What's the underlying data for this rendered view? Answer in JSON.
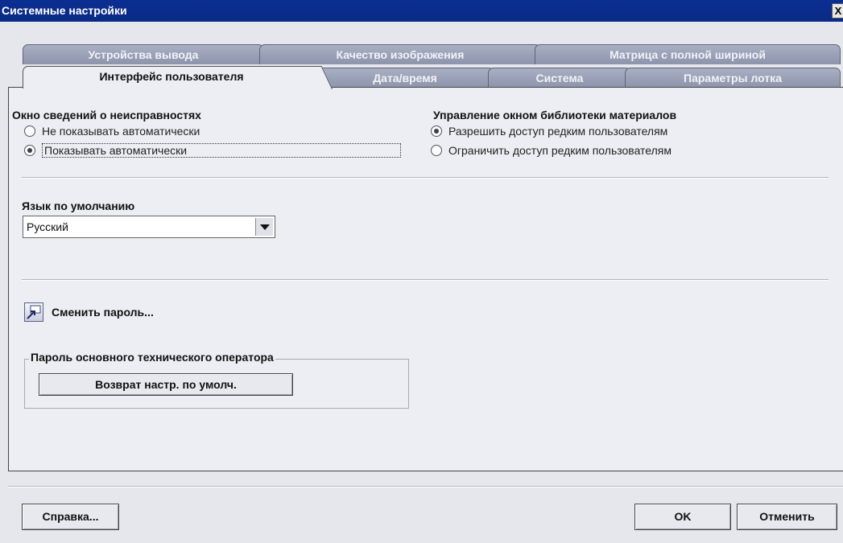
{
  "window": {
    "title": "Системные настройки",
    "close_label": "X"
  },
  "tabs": {
    "row1": [
      "Устройства вывода",
      "Качество изображения",
      "Матрица с полной шириной"
    ],
    "row2": [
      "Интерфейс пользователя",
      "Дата/время",
      "Система",
      "Параметры лотка"
    ],
    "active": "Интерфейс пользователя"
  },
  "fault_window": {
    "title": "Окно сведений о неисправностях",
    "options": [
      "Не показывать автоматически",
      "Показывать автоматически"
    ],
    "selected_index": 1
  },
  "library_window": {
    "title": "Управление окном библиотеки материалов",
    "options": [
      "Разрешить доступ редким пользователям",
      "Ограничить доступ редким пользователям"
    ],
    "selected_index": 0
  },
  "language": {
    "label": "Язык по умолчанию",
    "value": "Русский"
  },
  "change_password": {
    "label": "Сменить пароль...",
    "icon": "change-password-icon"
  },
  "admin_password": {
    "legend": "Пароль основного технического оператора",
    "reset_label": "Возврат настр. по умолч."
  },
  "footer": {
    "help_label": "Справка...",
    "ok_label": "OK",
    "cancel_label": "Отменить"
  }
}
